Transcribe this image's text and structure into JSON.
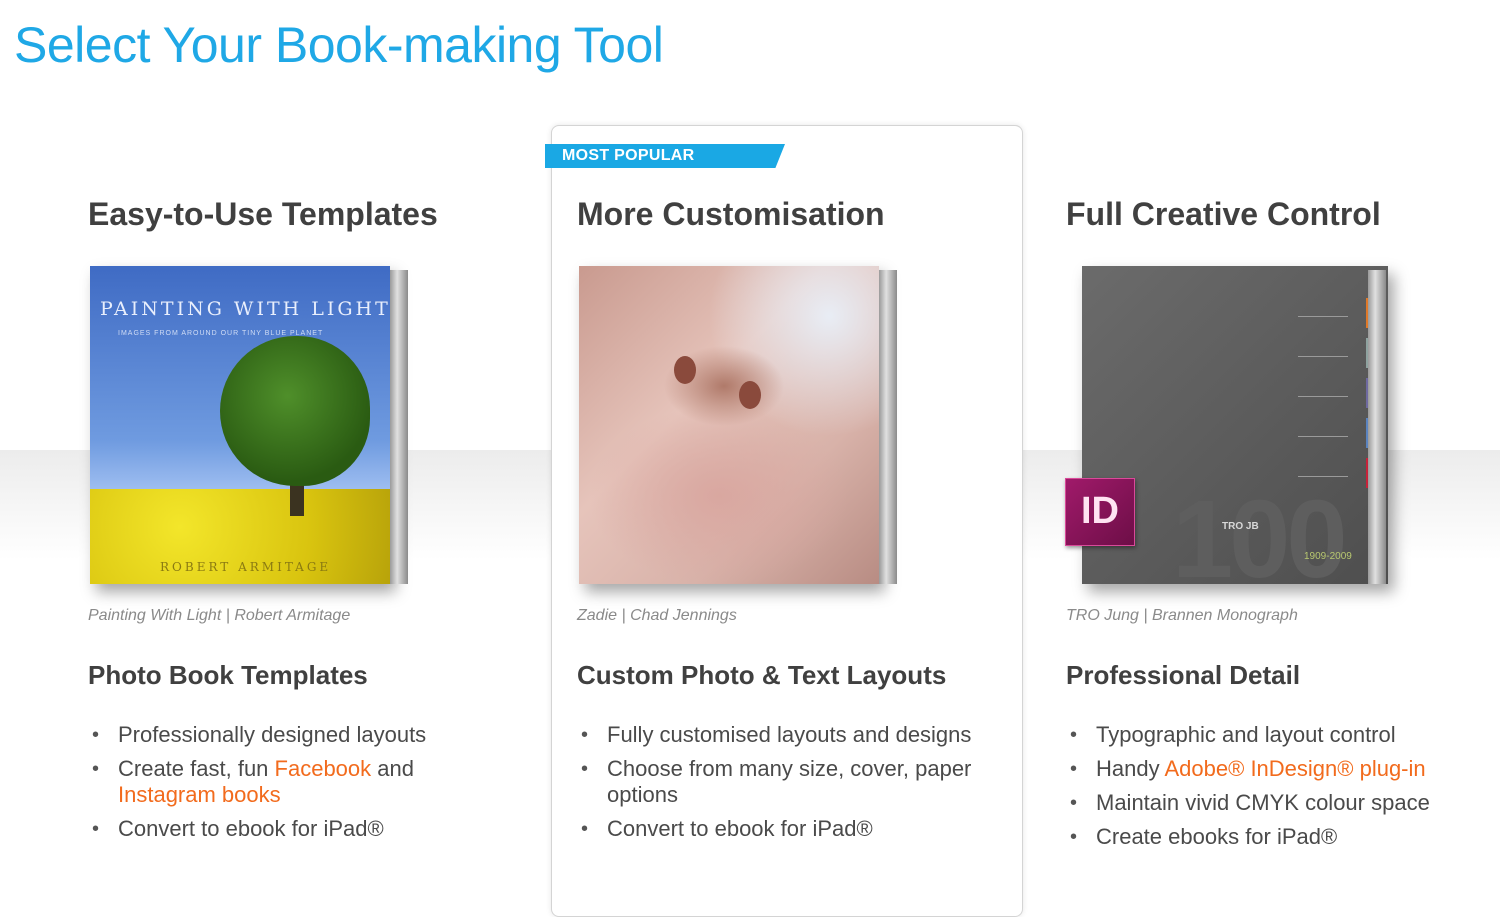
{
  "page": {
    "title": "Select Your Book-making Tool",
    "badge": "MOST POPULAR"
  },
  "accent_colors": {
    "title": "#1fa8e6",
    "badge": "#1aa8e4",
    "link": "#f26b1d"
  },
  "columns": [
    {
      "heading": "Easy-to-Use Templates",
      "book": {
        "cover_title": "PAINTING WITH LIGHT",
        "cover_subtitle": "IMAGES FROM AROUND OUR TINY BLUE PLANET",
        "cover_author": "ROBERT ARMITAGE"
      },
      "caption": "Painting With Light | Robert Armitage",
      "subheading": "Photo Book Templates",
      "bullets": {
        "b1": "Professionally designed layouts",
        "b2_pre": "Create fast, fun ",
        "b2_link1": "Facebook",
        "b2_mid": " and ",
        "b2_link2": "Instagram books",
        "b3": "Convert to ebook for iPad®"
      }
    },
    {
      "heading": "More Customisation",
      "caption": "Zadie | Chad Jennings",
      "subheading": "Custom Photo & Text Layouts",
      "bullets": {
        "b1": "Fully customised layouts and designs",
        "b2": "Choose from many size, cover, paper options",
        "b3": "Convert to ebook for iPad®"
      }
    },
    {
      "heading": "Full Creative Control",
      "book": {
        "cover_mark": "TRO JB",
        "cover_number": "100",
        "cover_years": "1909-2009",
        "badge_icon_text": "ID"
      },
      "caption": "TRO Jung | Brannen Monograph",
      "subheading": "Professional Detail",
      "bullets": {
        "b1": "Typographic and layout control",
        "b2_pre": "Handy ",
        "b2_link": "Adobe® InDesign® plug-in",
        "b3": "Maintain vivid CMYK colour space",
        "b4": "Create ebooks for iPad®"
      }
    }
  ]
}
